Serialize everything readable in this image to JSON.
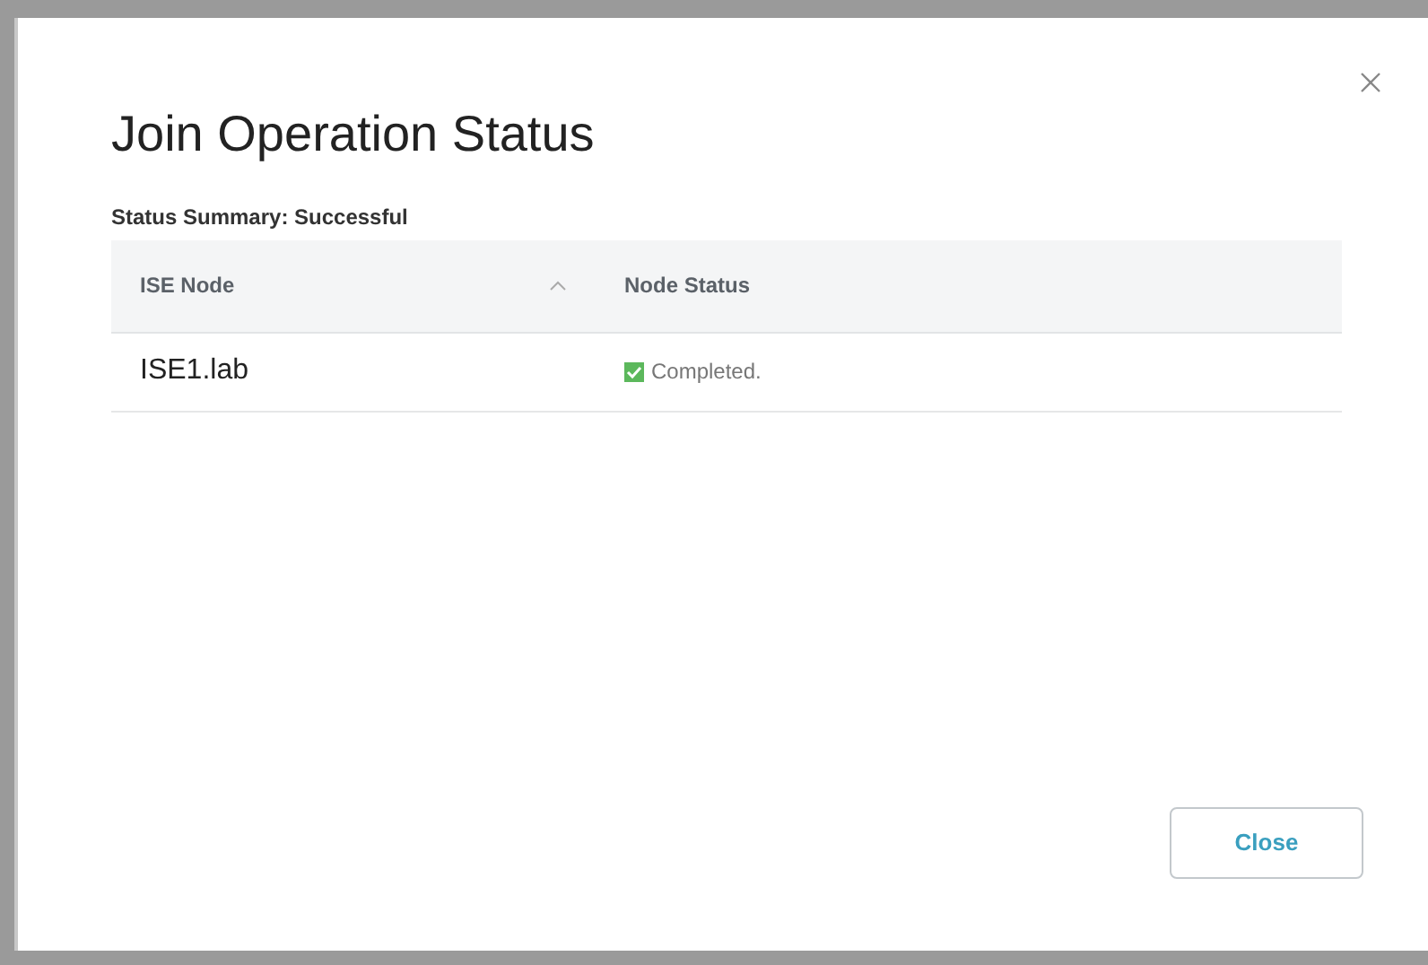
{
  "dialog": {
    "title": "Join Operation Status",
    "summary": "Status Summary: Successful"
  },
  "table": {
    "columns": [
      {
        "label": "ISE Node",
        "sorted": true
      },
      {
        "label": "Node Status",
        "sorted": false
      }
    ],
    "rows": [
      {
        "node": "ISE1.lab",
        "status": "Completed.",
        "kind": "success"
      }
    ]
  },
  "buttons": [
    {
      "label": "Close"
    }
  ]
}
